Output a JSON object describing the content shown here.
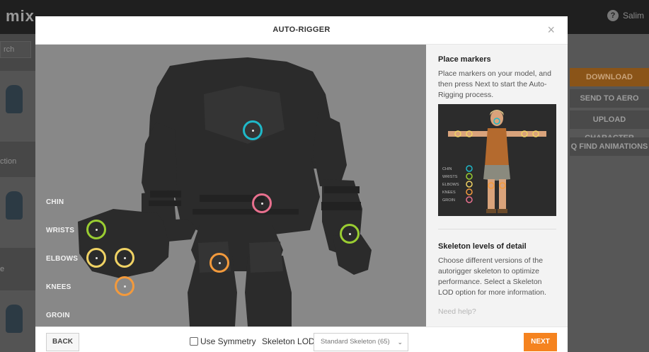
{
  "background": {
    "logo": "mix",
    "user": "Salim",
    "search_placeholder": "rch",
    "left_texts": [
      "ction",
      "e"
    ],
    "buttons": [
      "DOWNLOAD",
      "SEND TO AERO",
      "UPLOAD CHARACTER",
      "Q FIND ANIMATIONS"
    ]
  },
  "modal": {
    "title": "AUTO-RIGGER",
    "close": "×"
  },
  "viewport": {
    "labels": [
      "CHIN",
      "WRISTS",
      "ELBOWS",
      "KNEES",
      "GROIN"
    ],
    "marker_colors": {
      "chin": "#1fb8c8",
      "wrists": "#9acd32",
      "elbows": "#f0d264",
      "knees": "#f39a3c",
      "groin": "#e8708e"
    }
  },
  "sidepanel": {
    "place_heading": "Place markers",
    "place_text": "Place markers on your model, and then press Next to start the Auto-Rigging process.",
    "legend": [
      "CHIN",
      "WRISTS",
      "ELBOWS",
      "KNEES",
      "GROIN"
    ],
    "lod_heading": "Skeleton levels of detail",
    "lod_text": "Choose different versions of the autorigger skeleton to optimize performance. Select a Skeleton LOD option for more information.",
    "help": "Need help?"
  },
  "footer": {
    "back": "BACK",
    "symmetry": "Use Symmetry",
    "lod_label": "Skeleton LOD",
    "lod_value": "Standard Skeleton (65)",
    "next": "NEXT"
  }
}
